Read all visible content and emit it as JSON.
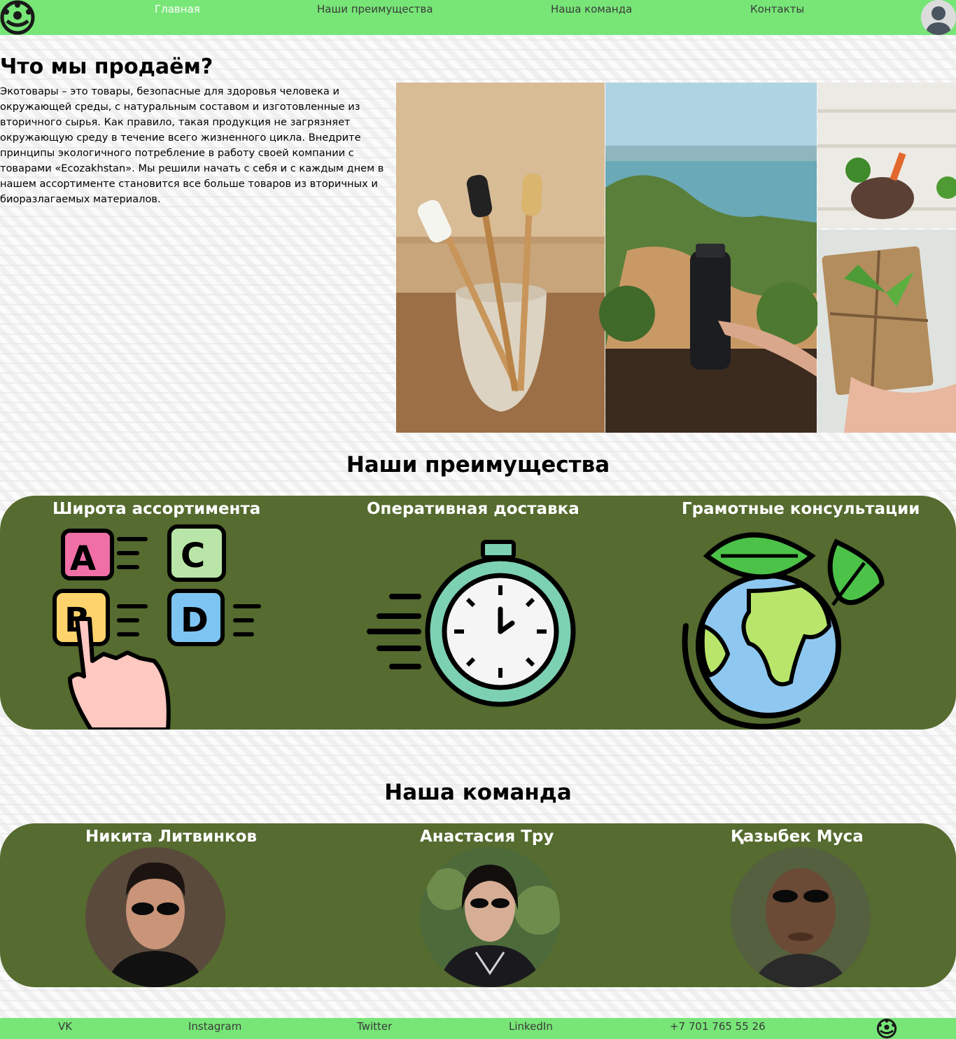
{
  "header": {
    "nav": [
      {
        "label": "Главная"
      },
      {
        "label": "Наши преимущества"
      },
      {
        "label": "Наша команда"
      },
      {
        "label": "Контакты"
      }
    ]
  },
  "sell": {
    "title": "Что мы продаём?",
    "text": "Экотовары – это товары, безопасные для здоровья человека и окружающей среды, с натуральным составом и изготовленные из вторичного сырья. Как правило, такая продукция не загрязняет окружающую среду в течение всего жизненного цикла. Внедрите принципы экологичного потребление в работу своей компании с товарами «Ecozakhstan». Мы решили начать с себя и с каждым днем в нашем ассортименте становится все больше товаров из вторичных и биоразлагаемых материалов."
  },
  "advantages": {
    "title": "Наши преимущества",
    "items": [
      {
        "title": "Широта ассортимента",
        "icon": "abcd-choice-icon"
      },
      {
        "title": "Оперативная доставка",
        "icon": "stopwatch-icon"
      },
      {
        "title": "Грамотные консультации",
        "icon": "earth-leaves-icon"
      }
    ]
  },
  "team": {
    "title": "Наша команда",
    "members": [
      {
        "name": "Никита Литвинков"
      },
      {
        "name": "Анастасия Тру"
      },
      {
        "name": "Қазыбек Муса"
      }
    ]
  },
  "footer": {
    "links": [
      {
        "label": "VK"
      },
      {
        "label": "Instagram"
      },
      {
        "label": "Twitter"
      },
      {
        "label": "LinkedIn"
      },
      {
        "label": "+7 701 765 55 26"
      }
    ]
  },
  "colors": {
    "header_bg": "#77e677",
    "panel_bg": "#556b2f",
    "active_nav": "#ffffff"
  }
}
